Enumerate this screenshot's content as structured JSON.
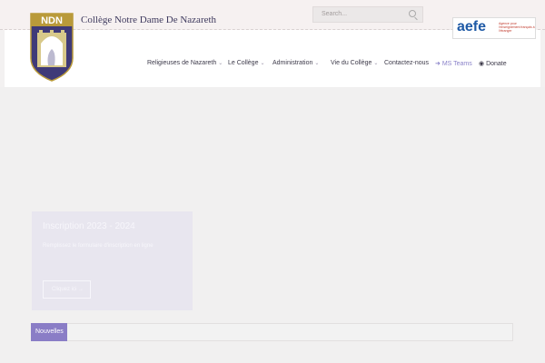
{
  "site": {
    "title": "Collège Notre Dame De Nazareth",
    "logo_text": "NDN"
  },
  "search": {
    "placeholder": "Search..."
  },
  "partner": {
    "name": "aefe",
    "tagline": "Agence pour l'enseignement français à l'étranger"
  },
  "nav": {
    "items": [
      {
        "label": "Religieuses de Nazareth",
        "has_dropdown": true
      },
      {
        "label": "Le Collège",
        "has_dropdown": true
      },
      {
        "label": "Administration",
        "has_dropdown": true
      },
      {
        "label": "Vie du Collège",
        "has_dropdown": true
      },
      {
        "label": "Contactez-nous",
        "has_dropdown": false
      },
      {
        "label": "MS Teams",
        "icon": "sign-in-icon"
      },
      {
        "label": "Donate",
        "icon": "eye-icon"
      }
    ]
  },
  "slider": {
    "title": "Inscription 2023 - 2024",
    "text": "Remplissez le formulaire d'inscription en ligne",
    "button_label": "Cliquez ici →"
  },
  "news": {
    "label": "Nouvelles"
  },
  "colors": {
    "accent": "#8a7dc6",
    "title": "#3e3a5e",
    "aefe_blue": "#1f5aa6"
  }
}
